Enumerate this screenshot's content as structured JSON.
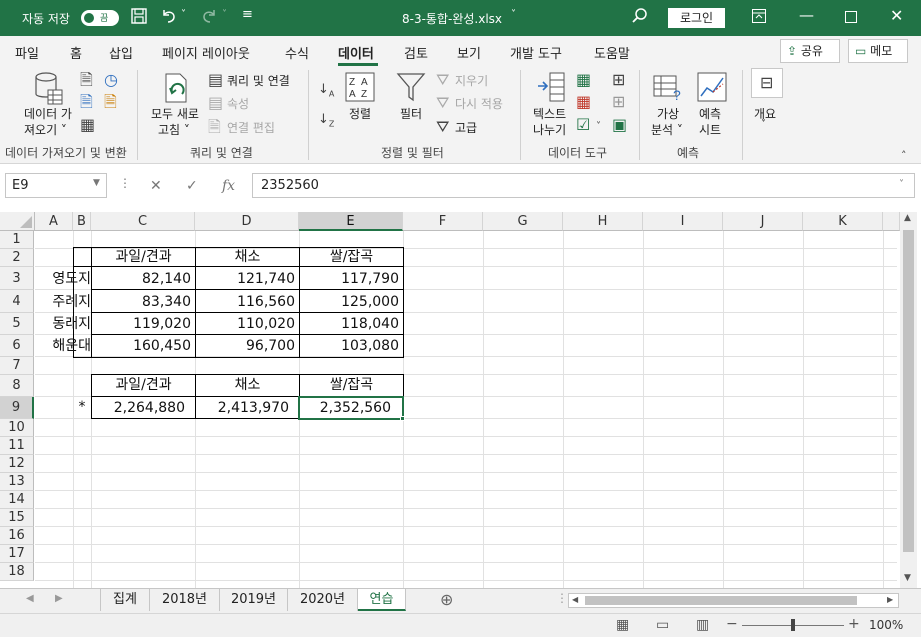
{
  "titlebar": {
    "autosave_label": "자동 저장",
    "autosave_state": "끔",
    "filename": "8-3-통합-완성.xlsx",
    "login_label": "로그인"
  },
  "ribbon_tabs": [
    "파일",
    "홈",
    "삽입",
    "페이지 레이아웃",
    "수식",
    "데이터",
    "검토",
    "보기",
    "개발 도구",
    "도움말"
  ],
  "active_tab": "데이터",
  "share_label": "공유",
  "comment_label": "메모",
  "ribbon": {
    "get_data": [
      "데이터 가",
      "져오기 ˅"
    ],
    "refresh_all": [
      "모두 새로",
      "고침 ˅"
    ],
    "queries_connections": "쿼리 및 연결",
    "properties": "속성",
    "edit_links": "연결 편집",
    "sort": "정렬",
    "filter": "필터",
    "clear": "지우기",
    "reapply": "다시 적용",
    "advanced": "고급",
    "text_to_columns": [
      "텍스트",
      "나누기"
    ],
    "what_if": [
      "가상",
      "분석 ˅"
    ],
    "forecast_sheet": [
      "예측",
      "시트"
    ],
    "outline": [
      "개요",
      "˅"
    ],
    "groups": [
      "데이터 가져오기 및 변환",
      "쿼리 및 연결",
      "정렬 및 필터",
      "데이터 도구",
      "예측"
    ]
  },
  "formula_bar": {
    "name_box": "E9",
    "formula": "2352560"
  },
  "columns": [
    "A",
    "B",
    "C",
    "D",
    "E",
    "F",
    "G",
    "H",
    "I",
    "J",
    "K"
  ],
  "selected_column": "E",
  "rows": [
    "1",
    "2",
    "3",
    "4",
    "5",
    "6",
    "7",
    "8",
    "9",
    "10",
    "11",
    "12",
    "13",
    "14",
    "15",
    "16",
    "17",
    "18"
  ],
  "selected_row": "9",
  "table1": {
    "headers": [
      "과일/견과",
      "채소",
      "쌀/잡곡"
    ],
    "rows": [
      {
        "label": "영도지",
        "values": [
          "82,140",
          "121,740",
          "117,790"
        ]
      },
      {
        "label": "주례지",
        "values": [
          "83,340",
          "116,560",
          "125,000"
        ]
      },
      {
        "label": "동래지",
        "values": [
          "119,020",
          "110,020",
          "118,040"
        ]
      },
      {
        "label": "해운대",
        "values": [
          "160,450",
          "96,700",
          "103,080"
        ]
      }
    ]
  },
  "table2": {
    "headers": [
      "과일/견과",
      "채소",
      "쌀/잡곡"
    ],
    "marker": "*",
    "values": [
      "2,264,880",
      "2,413,970",
      "2,352,560"
    ]
  },
  "sheet_tabs": [
    "집계",
    "2018년",
    "2019년",
    "2020년",
    "연습"
  ],
  "active_sheet": "연습",
  "zoom": "100%"
}
